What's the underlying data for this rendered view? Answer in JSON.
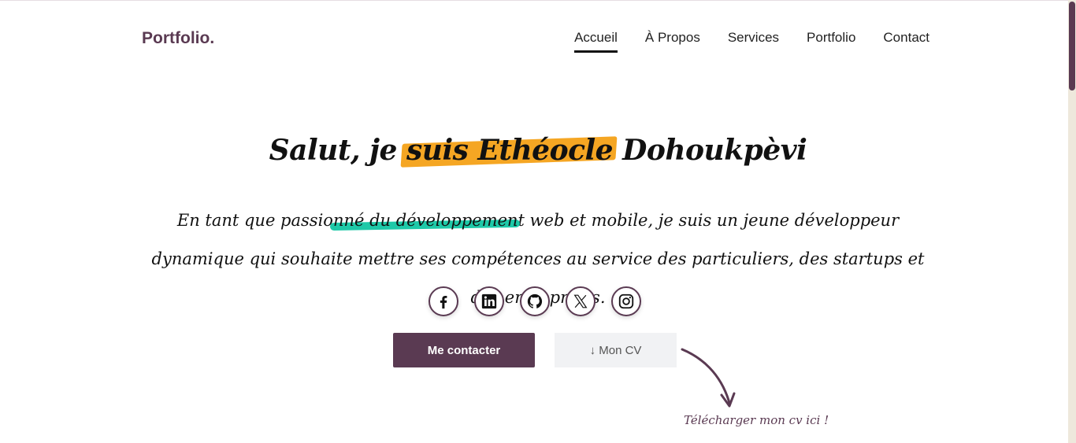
{
  "header": {
    "logo": "Portfolio.",
    "nav": [
      {
        "label": "Accueil",
        "active": true
      },
      {
        "label": "À Propos",
        "active": false
      },
      {
        "label": "Services",
        "active": false
      },
      {
        "label": "Portfolio",
        "active": false
      },
      {
        "label": "Contact",
        "active": false
      }
    ]
  },
  "hero": {
    "title_before": "Salut, je ",
    "title_highlight": "suis Ethéocle",
    "title_after": " Dohoukpèvi",
    "text_before": "En tant que passio",
    "text_highlight": "nné du développemen",
    "text_after": "t web et mobile, je suis un jeune développeur dynamique qui souhaite mettre ses compétences au service des particuliers, des startups et des entreprises."
  },
  "socials": [
    {
      "icon": "facebook-icon"
    },
    {
      "icon": "linkedin-icon"
    },
    {
      "icon": "github-icon"
    },
    {
      "icon": "x-icon"
    },
    {
      "icon": "instagram-icon"
    }
  ],
  "buttons": {
    "contact_label": "Me contacter",
    "cv_label": "↓ Mon CV"
  },
  "cv_hint": "Télécharger mon cv ici !",
  "colors": {
    "brand": "#5a3a52",
    "highlight_orange": "#f5a623",
    "highlight_teal": "#1ec9a8"
  }
}
